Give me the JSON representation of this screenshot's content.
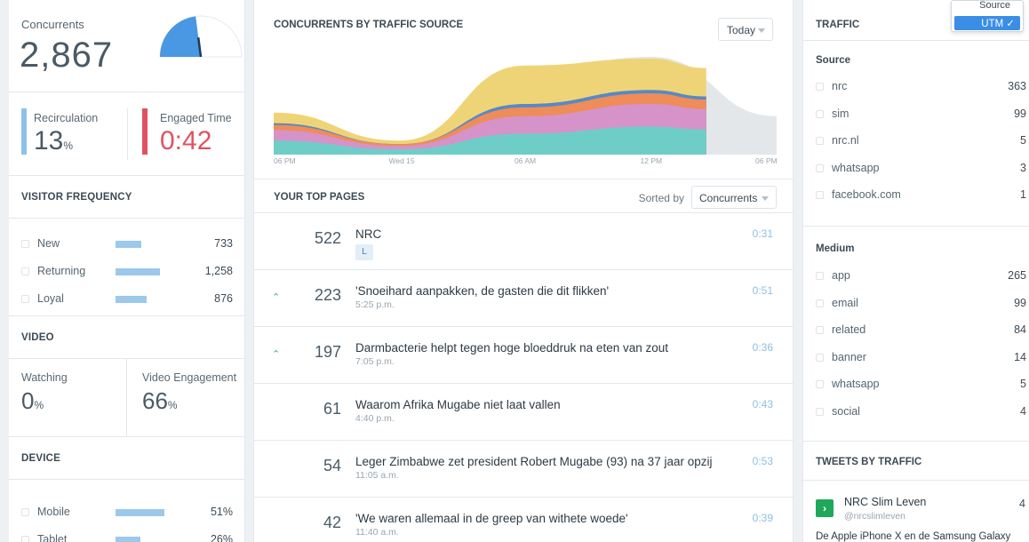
{
  "concurrents": {
    "label": "Concurrents",
    "value": "2,867",
    "gauge_fraction": 0.46
  },
  "recirculation": {
    "label": "Recirculation",
    "value": "13",
    "unit": "%",
    "color": "#8ec1ea"
  },
  "engaged": {
    "label": "Engaged Time",
    "value": "0:42",
    "color": "#e05260"
  },
  "visitor_frequency": {
    "title": "VISITOR FREQUENCY",
    "rows": [
      {
        "name": "New",
        "value": "733",
        "fraction": 0.58
      },
      {
        "name": "Returning",
        "value": "1,258",
        "fraction": 1.0
      },
      {
        "name": "Loyal",
        "value": "876",
        "fraction": 0.69
      }
    ]
  },
  "video": {
    "title": "VIDEO",
    "watching": {
      "label": "Watching",
      "value": "0",
      "unit": "%"
    },
    "engagement": {
      "label": "Video Engagement",
      "value": "66",
      "unit": "%"
    }
  },
  "device": {
    "title": "DEVICE",
    "rows": [
      {
        "name": "Mobile",
        "value": "51%",
        "fraction": 0.51
      },
      {
        "name": "Tablet",
        "value": "26%",
        "fraction": 0.26
      }
    ]
  },
  "chart": {
    "title": "CONCURRENTS BY TRAFFIC SOURCE",
    "range_select": "Today",
    "x_ticks": [
      "06 PM",
      "Wed 15",
      "06 AM",
      "12 PM",
      "06 PM"
    ]
  },
  "chart_data": {
    "type": "area",
    "x": [
      "06 PM",
      "Wed 15",
      "06 AM",
      "12 PM",
      "06 PM"
    ],
    "series": [
      {
        "color": "#6fcdc8",
        "values": [
          8,
          3,
          12,
          16,
          0
        ]
      },
      {
        "color": "#d693c9",
        "values": [
          6,
          2,
          10,
          13,
          0
        ]
      },
      {
        "color": "#ee8c5a",
        "values": [
          3,
          1,
          5,
          6,
          0
        ]
      },
      {
        "color": "#5889c4",
        "values": [
          1,
          0,
          2,
          2,
          0
        ]
      },
      {
        "color": "#efd477",
        "values": [
          6,
          2,
          22,
          18,
          0
        ]
      }
    ],
    "previous": {
      "color": "#e4e7ea",
      "values": [
        20,
        6,
        46,
        56,
        22
      ]
    }
  },
  "top_pages": {
    "title": "YOUR TOP PAGES",
    "sorted_label": "Sorted by",
    "sort_value": "Concurrents",
    "rows": [
      {
        "count": "522",
        "title": "NRC",
        "time": "",
        "tag": "L",
        "duration": "0:31",
        "trend_up": false
      },
      {
        "count": "223",
        "title": "'Snoeihard aanpakken, de gasten die dit flikken'",
        "time": "5:25 p.m.",
        "tag": "",
        "duration": "0:51",
        "trend_up": true
      },
      {
        "count": "197",
        "title": "Darmbacterie helpt tegen hoge bloeddruk na eten van zout",
        "time": "7:05 p.m.",
        "tag": "",
        "duration": "0:36",
        "trend_up": true
      },
      {
        "count": "61",
        "title": "Waarom Afrika Mugabe niet laat vallen",
        "time": "4:40 p.m.",
        "tag": "",
        "duration": "0:43",
        "trend_up": false
      },
      {
        "count": "54",
        "title": "Leger Zimbabwe zet president Robert Mugabe (93) na 37 jaar opzij",
        "time": "11:05 a.m.",
        "tag": "",
        "duration": "0:53",
        "trend_up": false
      },
      {
        "count": "42",
        "title": "'We waren allemaal in de greep van withete woede'",
        "time": "11:40 a.m.",
        "tag": "",
        "duration": "0:39",
        "trend_up": false
      }
    ]
  },
  "traffic": {
    "title": "TRAFFIC",
    "dropdown": {
      "option1": "Source",
      "option2": "UTM ✓"
    },
    "source_title": "Source",
    "sources": [
      {
        "name": "nrc",
        "value": "363"
      },
      {
        "name": "sim",
        "value": "99"
      },
      {
        "name": "nrc.nl",
        "value": "5"
      },
      {
        "name": "whatsapp",
        "value": "3"
      },
      {
        "name": "facebook.com",
        "value": "1"
      }
    ],
    "medium_title": "Medium",
    "mediums": [
      {
        "name": "app",
        "value": "265"
      },
      {
        "name": "email",
        "value": "99"
      },
      {
        "name": "related",
        "value": "84"
      },
      {
        "name": "banner",
        "value": "14"
      },
      {
        "name": "whatsapp",
        "value": "5"
      },
      {
        "name": "social",
        "value": "4"
      }
    ]
  },
  "tweets": {
    "title": "TWEETS BY TRAFFIC",
    "name": "NRC Slim Leven",
    "handle": "@nrcslimleven",
    "count": "4",
    "text": "De Apple iPhone X en de Samsung Galaxy"
  }
}
